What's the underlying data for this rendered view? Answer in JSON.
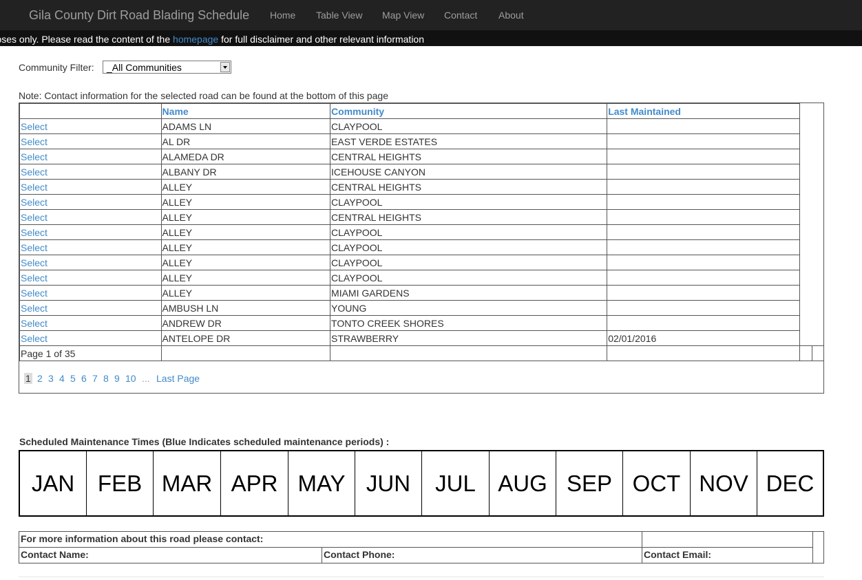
{
  "navbar": {
    "brand": "Gila County Dirt Road Blading Schedule",
    "links": [
      "Home",
      "Table View",
      "Map View",
      "Contact",
      "About"
    ]
  },
  "disclaimer": {
    "before": "rposes only. Please read the content of the ",
    "link": "homepage",
    "after": " for full disclaimer and other relevant information"
  },
  "filter": {
    "label": "Community Filter:",
    "selected": "_All Communities"
  },
  "note": "Note: Contact information for the selected road can be found at the bottom of this page",
  "table": {
    "headers": [
      "",
      "Name",
      "Community",
      "Last Maintained"
    ],
    "select_label": "Select",
    "rows": [
      {
        "name": "ADAMS LN",
        "community": "CLAYPOOL",
        "last": ""
      },
      {
        "name": "AL DR",
        "community": "EAST VERDE ESTATES",
        "last": ""
      },
      {
        "name": "ALAMEDA DR",
        "community": "CENTRAL HEIGHTS",
        "last": ""
      },
      {
        "name": "ALBANY DR",
        "community": "ICEHOUSE CANYON",
        "last": ""
      },
      {
        "name": "ALLEY",
        "community": "CENTRAL HEIGHTS",
        "last": ""
      },
      {
        "name": "ALLEY",
        "community": "CLAYPOOL",
        "last": ""
      },
      {
        "name": "ALLEY",
        "community": "CENTRAL HEIGHTS",
        "last": ""
      },
      {
        "name": "ALLEY",
        "community": "CLAYPOOL",
        "last": ""
      },
      {
        "name": "ALLEY",
        "community": "CLAYPOOL",
        "last": ""
      },
      {
        "name": "ALLEY",
        "community": "CLAYPOOL",
        "last": ""
      },
      {
        "name": "ALLEY",
        "community": "CLAYPOOL",
        "last": ""
      },
      {
        "name": "ALLEY",
        "community": "MIAMI GARDENS",
        "last": ""
      },
      {
        "name": "AMBUSH LN",
        "community": "YOUNG",
        "last": ""
      },
      {
        "name": "ANDREW DR",
        "community": "TONTO CREEK SHORES",
        "last": ""
      },
      {
        "name": "ANTELOPE DR",
        "community": "STRAWBERRY",
        "last": "02/01/2016"
      }
    ],
    "page_info": "Page 1 of 35"
  },
  "pager": {
    "current": "1",
    "pages": [
      "2",
      "3",
      "4",
      "5",
      "6",
      "7",
      "8",
      "9",
      "10"
    ],
    "ellipsis": "...",
    "last": "Last Page"
  },
  "schedule": {
    "title": "Scheduled Maintenance Times (Blue Indicates scheduled maintenance periods) :",
    "months": [
      "JAN",
      "FEB",
      "MAR",
      "APR",
      "MAY",
      "JUN",
      "JUL",
      "AUG",
      "SEP",
      "OCT",
      "NOV",
      "DEC"
    ]
  },
  "contact": {
    "heading": "For more information about this road please contact:",
    "name_label": "Contact Name:",
    "phone_label": "Contact Phone:",
    "email_label": "Contact Email:"
  },
  "colors": {
    "navbar_bg": "#222222",
    "disclaimer_bg": "#111111",
    "link": "#428bca"
  }
}
